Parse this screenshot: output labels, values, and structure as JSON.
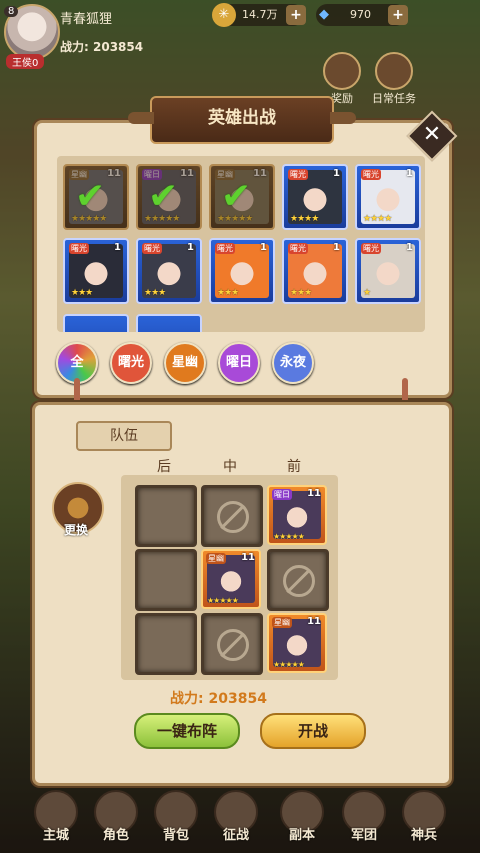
{
  "player": {
    "level": "8",
    "name": "青春狐狸",
    "power_label": "战力:",
    "power": "203854",
    "rank": "王侯0"
  },
  "resources": [
    {
      "icon": "coin-icon",
      "value": "14.7万"
    },
    {
      "icon": "diamond-icon",
      "value": "970"
    }
  ],
  "shortcuts": [
    {
      "icon": "gift-icon",
      "label": "奖励"
    },
    {
      "icon": "task-icon",
      "label": "日常任务"
    }
  ],
  "dialog": {
    "title": "英雄出战",
    "close": "✕"
  },
  "hero_cards": [
    {
      "tag": "星幽",
      "num": "11",
      "stars": "★★★★★",
      "selected": true,
      "frame": "brown"
    },
    {
      "tag": "曜日",
      "num": "11",
      "stars": "★★★★★",
      "selected": true,
      "frame": "brown"
    },
    {
      "tag": "星幽",
      "num": "11",
      "stars": "★★★★★",
      "selected": true,
      "frame": "brown"
    },
    {
      "tag": "曙光",
      "num": "1",
      "stars": "★★★★",
      "selected": false,
      "frame": "blue"
    },
    {
      "tag": "曙光",
      "num": "1",
      "stars": "★★★★",
      "selected": false,
      "frame": "blue"
    },
    {
      "tag": "曙光",
      "num": "1",
      "stars": "★★★",
      "selected": false,
      "frame": "blue"
    },
    {
      "tag": "曙光",
      "num": "1",
      "stars": "★★★",
      "selected": false,
      "frame": "blue"
    },
    {
      "tag": "曙光",
      "num": "1",
      "stars": "★★★",
      "selected": false,
      "frame": "blue"
    },
    {
      "tag": "曙光",
      "num": "1",
      "stars": "★★★",
      "selected": false,
      "frame": "blue"
    },
    {
      "tag": "曙光",
      "num": "1",
      "stars": "★",
      "selected": false,
      "frame": "blue"
    }
  ],
  "filters": [
    {
      "label": "全",
      "color": "#c84a78"
    },
    {
      "label": "曙光",
      "color": "#e0553a"
    },
    {
      "label": "星幽",
      "color": "#e07a1e"
    },
    {
      "label": "曜日",
      "color": "#a84ad8"
    },
    {
      "label": "永夜",
      "color": "#5a7ae0"
    }
  ],
  "team": {
    "tab": "队伍",
    "columns": [
      "后",
      "中",
      "前"
    ],
    "swap": "更换",
    "power_label": "战力:",
    "power": "203854",
    "auto_button": "一键布阵",
    "fight_button": "开战",
    "slots": [
      {
        "state": "empty"
      },
      {
        "state": "blocked"
      },
      {
        "state": "hero",
        "tag": "曜日",
        "num": "11",
        "stars": "★★★★★"
      },
      {
        "state": "empty"
      },
      {
        "state": "hero",
        "tag": "星幽",
        "num": "11",
        "stars": "★★★★★"
      },
      {
        "state": "blocked"
      },
      {
        "state": "empty"
      },
      {
        "state": "blocked"
      },
      {
        "state": "hero",
        "tag": "星幽",
        "num": "11",
        "stars": "★★★★★"
      }
    ]
  },
  "nav": [
    "主城",
    "角色",
    "背包",
    "征战",
    "副本",
    "军团",
    "神兵"
  ]
}
